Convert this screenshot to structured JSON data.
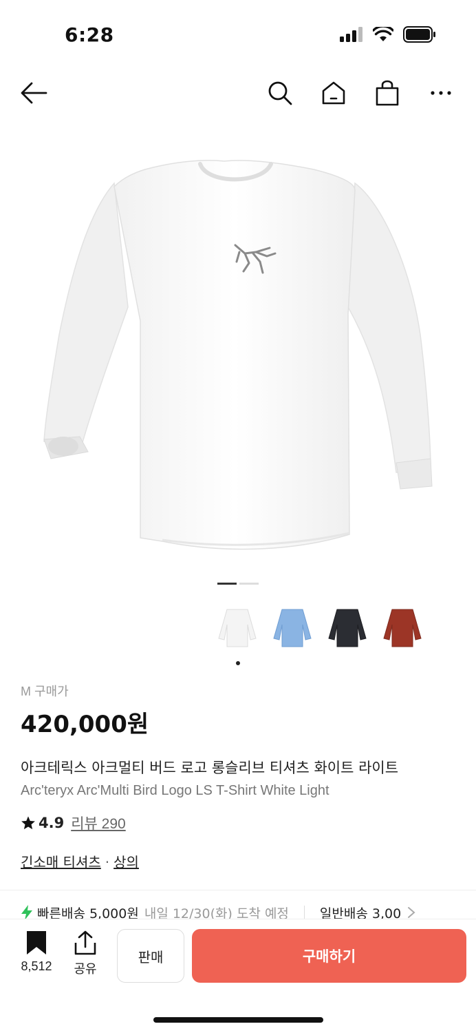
{
  "status": {
    "time": "6:28"
  },
  "nav": {
    "icons": [
      "back-arrow-icon",
      "search-icon",
      "home-icon",
      "shopping-bag-icon",
      "more-icon"
    ]
  },
  "product": {
    "price_label": "M 구매가",
    "price": "420,000원",
    "title_ko": "아크테릭스 아크멀티 버드 로고 롱슬리브 티셔츠 화이트 라이트",
    "title_en": "Arc'teryx Arc'Multi Bird Logo LS T-Shirt White Light",
    "rating": "4.9",
    "review_label": "리뷰 290",
    "category_main": "긴소매 티셔츠",
    "category_sep": "·",
    "category_sub": "상의"
  },
  "gallery": {
    "page_count": 2,
    "active_page": 0,
    "thumb_colors": [
      "#f4f4f4",
      "#8ab4e3",
      "#2b2d33",
      "#9c3526"
    ]
  },
  "shipping": {
    "fast_label": "빠른배송 5,000원",
    "fast_date": "내일 12/30(화) 도착 예정",
    "normal_label": "일반배송 3,00"
  },
  "bottom": {
    "bookmark_count": "8,512",
    "share_label": "공유",
    "sell_label": "판매",
    "buy_label": "구매하기"
  },
  "colors": {
    "accent": "#ef6253",
    "fast_icon": "#2fc15a"
  }
}
